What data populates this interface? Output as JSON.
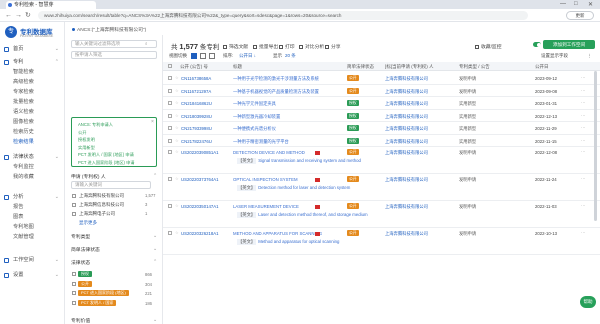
{
  "browser": {
    "tab_title": "专利检索 - 智慧芽",
    "url": "www.zhihuiya.com/search/result/table?q=ANCS%3A%22上海奔腾科技有限公司%22&_type=query&sort=sdesc&page=1&rows=20&source=search",
    "update_label": "更新"
  },
  "sidebar": {
    "logo_glyph": "专",
    "title": "专利数据库",
    "subtitle": "PATENT DATABASE",
    "items": [
      {
        "label": "首页",
        "type": "top"
      },
      {
        "label": "专利",
        "type": "top",
        "expanded": true
      },
      {
        "label": "智能检索",
        "type": "sub"
      },
      {
        "label": "高级检索",
        "type": "sub"
      },
      {
        "label": "专家检索",
        "type": "sub"
      },
      {
        "label": "批量检索",
        "type": "sub"
      },
      {
        "label": "语义检索",
        "type": "sub"
      },
      {
        "label": "图像检索",
        "type": "sub"
      },
      {
        "label": "检索历史",
        "type": "sub"
      },
      {
        "label": "检索结果",
        "type": "sub",
        "active": true
      },
      {
        "label": "法律状态",
        "type": "top"
      },
      {
        "label": "专利监控",
        "type": "sub"
      },
      {
        "label": "我的收藏",
        "type": "sub"
      },
      {
        "label": "分析",
        "type": "top"
      },
      {
        "label": "报告",
        "type": "sub"
      },
      {
        "label": "图表",
        "type": "sub"
      },
      {
        "label": "专利地图",
        "type": "sub"
      },
      {
        "label": "文献管理",
        "type": "sub"
      },
      {
        "label": "工作空间",
        "type": "top"
      },
      {
        "label": "设置",
        "type": "top"
      }
    ]
  },
  "breadcrumb": "ANCS:(\"上海奔腾科技有限公司\")",
  "filters": {
    "search_placeholder": "输入关键词过滤筛选项",
    "sort_placeholder": "按申请人筛选",
    "query_lines": [
      "ANCS: 专利申请人",
      "公开",
      "授权发明",
      "实用新型",
      "PCT 发明人 / 国家 (地区) 申请",
      "PCT 进入国家阶段 (地区) 申请"
    ],
    "applicant_section": "申请 (专利权) 人",
    "applicant_placeholder": "请输入关键词",
    "applicants": [
      {
        "name": "上海奔腾科技有限公司",
        "count": "1,577"
      },
      {
        "name": "上海奔腾信息科技公司",
        "count": "3"
      },
      {
        "name": "上海奔腾电子公司",
        "count": "1"
      },
      {
        "name": "显示更多",
        "count": ""
      }
    ],
    "sections": [
      "专利类型",
      "简单法律状态",
      "法律状态"
    ],
    "legal_tags": [
      {
        "label": "授权",
        "color": "#2a9b56",
        "count": "866"
      },
      {
        "label": "公开",
        "color": "#e48a1d",
        "count": "304"
      },
      {
        "label": "PCT 进入国家阶段 (地区)",
        "color": "#e48a1d",
        "count": "221"
      },
      {
        "label": "PCT 发明人 / 国家",
        "color": "#e48a1d",
        "count": "186"
      }
    ],
    "more_sections": [
      "专利价值"
    ]
  },
  "results": {
    "total_prefix": "共",
    "total": "1,577",
    "total_suffix": "条专利",
    "toolbar": [
      "筛选文献",
      "批量导出",
      "打印",
      "对比分析",
      "分享"
    ],
    "toolbar_right": [
      "收藏/监控",
      "设置显示字段"
    ],
    "add_button": "添加到工作空间",
    "view_label": "视图切换",
    "sort_label": "排序:",
    "sort_value": "公开日 ↓",
    "display_label": "显示",
    "display_value": "20 条",
    "columns": [
      "公开 (公告) 号",
      "标题",
      "简单法律状态",
      "[标]当前申请 (专利权) 人",
      "专利类型 / 公告",
      "公开日"
    ],
    "rows": [
      {
        "pn": "CN116738658A",
        "title": "一种用于光学检测的激光干涉测量方法及系统",
        "status": "公开",
        "status_color": "#e48a1d",
        "applicant": "上海奔腾科技有限公司",
        "type": "发明申请",
        "date": "2023-09-12"
      },
      {
        "pn": "CN116721297A",
        "title": "一种基于机器视觉的产品质量检测方法及装置",
        "status": "公开",
        "status_color": "#e48a1d",
        "applicant": "上海奔腾科技有限公司",
        "type": "发明申请",
        "date": "2023-09-08"
      },
      {
        "pn": "CN218416862U",
        "title": "一种光学元件固定夹具",
        "status": "授权",
        "status_color": "#2a9b56",
        "applicant": "上海奔腾科技有限公司",
        "type": "实用新型",
        "date": "2023-01-31"
      },
      {
        "pn": "CN218039928U",
        "title": "一种新型激光器冷却装置",
        "status": "授权",
        "status_color": "#2a9b56",
        "applicant": "上海奔腾科技有限公司",
        "type": "实用新型",
        "date": "2022-12-13"
      },
      {
        "pn": "CN217933998U",
        "title": "一种便携式光谱分析仪",
        "status": "授权",
        "status_color": "#2a9b56",
        "applicant": "上海奔腾科技有限公司",
        "type": "实用新型",
        "date": "2022-11-29"
      },
      {
        "pn": "CN217822476U",
        "title": "一种用于精密测量的光学平台",
        "status": "授权",
        "status_color": "#2a9b56",
        "applicant": "上海奔腾科技有限公司",
        "type": "实用新型",
        "date": "2022-11-15"
      },
      {
        "pn": "US20220390851A1",
        "title": "DETECTION DEVICE AND METHOD",
        "en_tag": "【英文】",
        "en_title": "Signal transmission and receiving system and method",
        "status": "公开",
        "status_color": "#e48a1d",
        "applicant": "上海奔腾科技有限公司",
        "type": "发明申请",
        "date": "2022-12-08"
      },
      {
        "pn": "US20220373764A1",
        "title": "OPTICAL INSPECTION SYSTEM",
        "en_tag": "【英文】",
        "en_title": "Detection method for laser and detection system",
        "status": "公开",
        "status_color": "#e48a1d",
        "applicant": "上海奔腾科技有限公司",
        "type": "发明申请",
        "date": "2022-11-24"
      },
      {
        "pn": "US20220350147A1",
        "title": "LASER MEASUREMENT DEVICE",
        "en_tag": "【英文】",
        "en_title": "Laser and detection method thereof, and storage medium",
        "status": "公开",
        "status_color": "#e48a1d",
        "applicant": "上海奔腾科技有限公司",
        "type": "发明申请",
        "date": "2022-11-03"
      },
      {
        "pn": "US20220326218A1",
        "title": "METHOD AND APPARATUS FOR SCANNING",
        "en_tag": "【英文】",
        "en_title": "Method and apparatus for optical scanning",
        "status": "公开",
        "status_color": "#e48a1d",
        "applicant": "上海奔腾科技有限公司",
        "type": "发明申请",
        "date": "2022-10-13"
      }
    ]
  },
  "help_label": "帮助"
}
